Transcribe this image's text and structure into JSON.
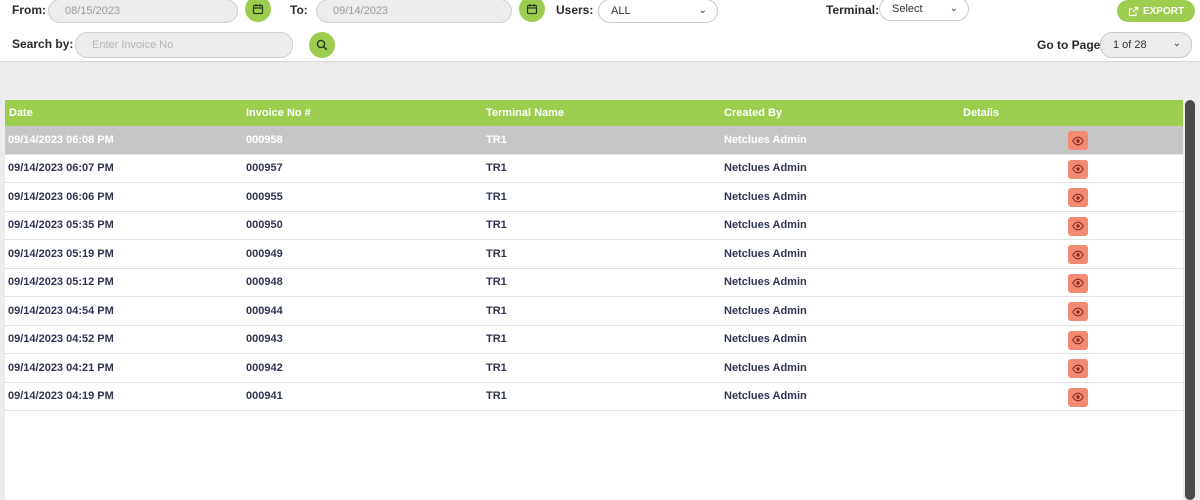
{
  "filters": {
    "from_label": "From:",
    "from_value": "08/15/2023",
    "to_label": "To:",
    "to_value": "09/14/2023",
    "users_label": "Users:",
    "users_value": "ALL",
    "terminal_label": "Terminal:",
    "terminal_value": "Select",
    "export_label": "EXPORT",
    "search_label": "Search by:",
    "search_placeholder": "Enter Invoice No",
    "goto_label": "Go to Page",
    "goto_value": "1 of 28"
  },
  "table": {
    "headers": {
      "date": "Date",
      "invoice": "Invoice No #",
      "terminal": "Terminal Name",
      "created_by": "Created By",
      "details": "Details"
    },
    "rows": [
      {
        "date": "09/14/2023 06:08 PM",
        "invoice": "000958",
        "terminal": "TR1",
        "created_by": "Netclues Admin"
      },
      {
        "date": "09/14/2023 06:07 PM",
        "invoice": "000957",
        "terminal": "TR1",
        "created_by": "Netclues Admin"
      },
      {
        "date": "09/14/2023 06:06 PM",
        "invoice": "000955",
        "terminal": "TR1",
        "created_by": "Netclues Admin"
      },
      {
        "date": "09/14/2023 05:35 PM",
        "invoice": "000950",
        "terminal": "TR1",
        "created_by": "Netclues Admin"
      },
      {
        "date": "09/14/2023 05:19 PM",
        "invoice": "000949",
        "terminal": "TR1",
        "created_by": "Netclues Admin"
      },
      {
        "date": "09/14/2023 05:12 PM",
        "invoice": "000948",
        "terminal": "TR1",
        "created_by": "Netclues Admin"
      },
      {
        "date": "09/14/2023 04:54 PM",
        "invoice": "000944",
        "terminal": "TR1",
        "created_by": "Netclues Admin"
      },
      {
        "date": "09/14/2023 04:52 PM",
        "invoice": "000943",
        "terminal": "TR1",
        "created_by": "Netclues Admin"
      },
      {
        "date": "09/14/2023 04:21 PM",
        "invoice": "000942",
        "terminal": "TR1",
        "created_by": "Netclues Admin"
      },
      {
        "date": "09/14/2023 04:19 PM",
        "invoice": "000941",
        "terminal": "TR1",
        "created_by": "Netclues Admin"
      }
    ]
  },
  "icons": {
    "calendar": "calendar-icon",
    "search": "search-icon",
    "export": "external-link-icon",
    "details": "eye-icon",
    "dropdown": "chevron-down-icon"
  },
  "colors": {
    "accent_green": "#9ccd4f",
    "details_button": "#f28b72",
    "selected_row": "#c6c6c6",
    "row_text": "#2f3550"
  }
}
